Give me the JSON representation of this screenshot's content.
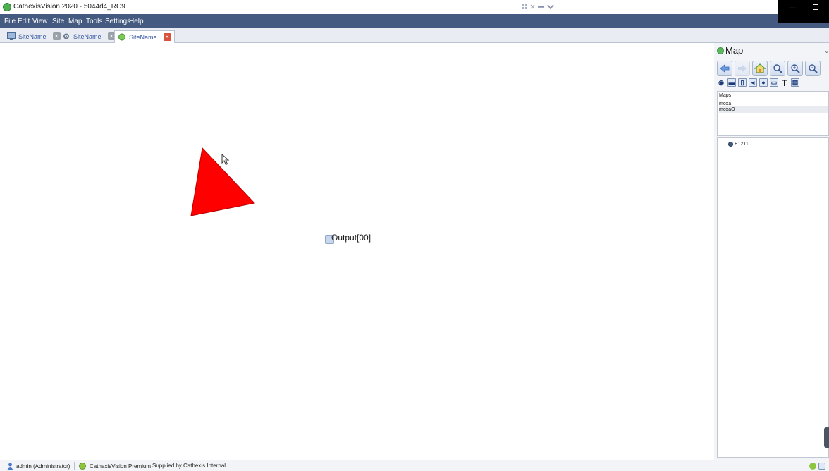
{
  "window": {
    "title": "CathexisVision 2020 - 5044d4_RC9"
  },
  "menu": {
    "items": [
      "File",
      "Edit",
      "View",
      "Site",
      "Map",
      "Tools",
      "Settings",
      "Help"
    ]
  },
  "tabs": [
    {
      "label": "SiteName",
      "icon": "monitor-icon",
      "active": false
    },
    {
      "label": "SiteName",
      "icon": "gear-icon",
      "active": false
    },
    {
      "label": "SiteName",
      "icon": "site-globe-icon",
      "active": true
    }
  ],
  "canvas": {
    "output_label": "Output[00]",
    "triangle_color": "#ff0000"
  },
  "map_panel": {
    "title": "Map",
    "nav_buttons": [
      "back-arrow-icon",
      "forward-arrow-icon",
      "home-icon",
      "zoom-fit-icon",
      "zoom-in-icon",
      "zoom-out-icon"
    ],
    "tool_buttons": [
      "eye-icon",
      "camera-icon",
      "door-icon",
      "speaker-icon",
      "record-icon",
      "image-icon",
      "text-icon",
      "print-icon"
    ],
    "maps_header": "Maps",
    "maps": [
      "moxa",
      "moxaO"
    ],
    "selected_map_index": 1,
    "tree_item": "E1211"
  },
  "status": {
    "user": "admin (Administrator)",
    "product": "CathexisVision Premium",
    "supplier": "Supplied by Cathexis Internal"
  },
  "colors": {
    "menubar": "#445a80",
    "tab_text": "#3656a0",
    "active_close": "#d9503c",
    "accent_green": "#5cb85c"
  }
}
